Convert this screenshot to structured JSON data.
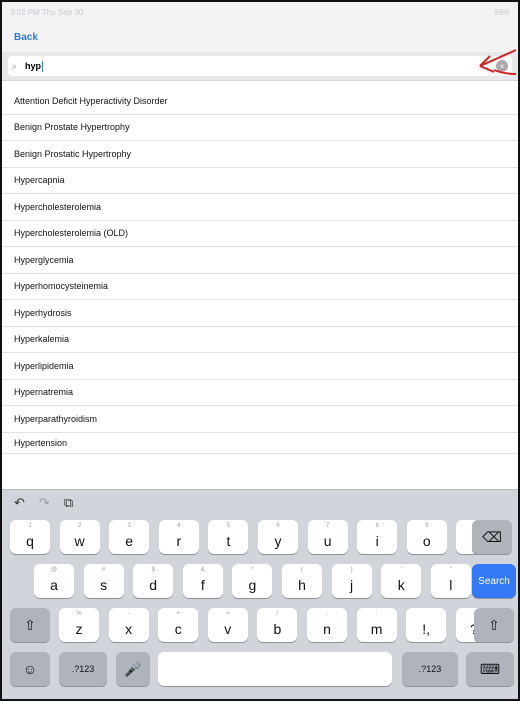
{
  "status": {
    "time": "3:02 PM  Thu Sep 30",
    "battery": "99%"
  },
  "nav": {
    "back_label": "Back"
  },
  "search": {
    "value": "hyp"
  },
  "results": [
    "Attention Deficit Hyperactivity Disorder",
    "Benign Prostate Hypertrophy",
    "Benign Prostatic Hypertrophy",
    "Hypercapnia",
    "Hypercholesterolemia",
    "Hypercholesterolemia (OLD)",
    "Hyperglycemia",
    "Hyperhomocysteinemia",
    "Hyperhydrosis",
    "Hyperkalemia",
    "Hyperlipidemia",
    "Hypernatremia",
    "Hyperparathyroidism",
    "Hypertension"
  ],
  "keyboard": {
    "toolbar": {
      "undo": "↶",
      "redo": "↷",
      "paste": "⧉"
    },
    "row1": [
      {
        "hint": "1",
        "key": "q"
      },
      {
        "hint": "2",
        "key": "w"
      },
      {
        "hint": "3",
        "key": "e"
      },
      {
        "hint": "4",
        "key": "r"
      },
      {
        "hint": "5",
        "key": "t"
      },
      {
        "hint": "6",
        "key": "y"
      },
      {
        "hint": "7",
        "key": "u"
      },
      {
        "hint": "8",
        "key": "i"
      },
      {
        "hint": "9",
        "key": "o"
      },
      {
        "hint": "0",
        "key": "p"
      }
    ],
    "backspace": "⌫",
    "row2": [
      {
        "hint": "@",
        "key": "a"
      },
      {
        "hint": "#",
        "key": "s"
      },
      {
        "hint": "$",
        "key": "d"
      },
      {
        "hint": "&",
        "key": "f"
      },
      {
        "hint": "*",
        "key": "g"
      },
      {
        "hint": "(",
        "key": "h"
      },
      {
        "hint": ")",
        "key": "j"
      },
      {
        "hint": "'",
        "key": "k"
      },
      {
        "hint": "\"",
        "key": "l"
      }
    ],
    "search_key": "Search",
    "shift": "⇧",
    "row3": [
      {
        "hint": "%",
        "key": "z"
      },
      {
        "hint": "-",
        "key": "x"
      },
      {
        "hint": "+",
        "key": "c"
      },
      {
        "hint": "=",
        "key": "v"
      },
      {
        "hint": "/",
        "key": "b"
      },
      {
        "hint": ";",
        "key": "n"
      },
      {
        "hint": ":",
        "key": "m"
      },
      {
        "hint": "",
        "key": "!,"
      },
      {
        "hint": "",
        "key": "?."
      }
    ],
    "emoji": "☺",
    "numbers": ".?123",
    "mic": "🎤",
    "keyboard_hide": "⌨"
  }
}
